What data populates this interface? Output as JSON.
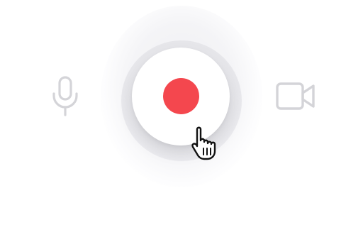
{
  "icons": {
    "microphone": "microphone-icon",
    "record_dot": "record-dot-icon",
    "video_camera": "video-camera-icon",
    "hand_cursor": "hand-pointer-cursor"
  },
  "colors": {
    "record_accent": "#f4474e",
    "icon_inactive": "#d4d4d8",
    "button_face": "#ffffff",
    "ring": "#e6e6ea"
  }
}
